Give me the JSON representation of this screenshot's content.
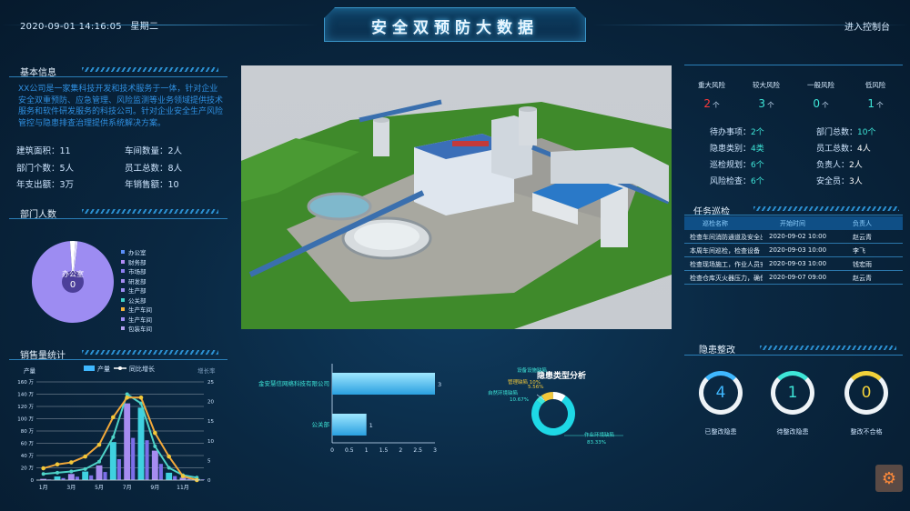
{
  "header": {
    "datetime": "2020-09-01 14:16:05",
    "weekday": "星期二",
    "title": "安全双预防大数据",
    "console_link": "进入控制台"
  },
  "basic_info": {
    "title": "基本信息",
    "description": "XX公司是一家集科技开发和技术服务于一体，针对企业安全双重预防、应急管理、风险监测等业务领域提供技术服务和软件研发服务的科技公司。针对企业安全生产风险管控与隐患排查治理提供系统解决方案。",
    "items": [
      {
        "label": "建筑面积：",
        "value": "11"
      },
      {
        "label": "车间数量：",
        "value": "2人"
      },
      {
        "label": "部门个数：",
        "value": "5人"
      },
      {
        "label": "员工总数：",
        "value": "8人"
      },
      {
        "label": "年支出额：",
        "value": "3万"
      },
      {
        "label": "年销售额：",
        "value": "10"
      }
    ]
  },
  "dept_people": {
    "title": "部门人数",
    "center_label": "办公室",
    "center_value": "0",
    "legend": [
      {
        "name": "办公室",
        "color": "#5b8ff9"
      },
      {
        "name": "财务部",
        "color": "#b28bf5"
      },
      {
        "name": "市场部",
        "color": "#8d7ef2"
      },
      {
        "name": "研发部",
        "color": "#a58cf0"
      },
      {
        "name": "生产部",
        "color": "#9c8cf2"
      },
      {
        "name": "公关部",
        "color": "#3fd1c8"
      },
      {
        "name": "生产车间",
        "color": "#f2b23a"
      },
      {
        "name": "生产车间",
        "color": "#9e8cf2"
      },
      {
        "name": "包装车间",
        "color": "#b3a0f0"
      }
    ],
    "pie": [
      {
        "name": "包装车间",
        "value": 97,
        "color": "#9d8cf2"
      },
      {
        "name": "办公室",
        "value": 2,
        "color": "#ffffff"
      },
      {
        "name": "生产车间",
        "value": 1,
        "color": "#e2dcff"
      }
    ]
  },
  "sales_stats": {
    "title": "销售量统计",
    "legend_bar": "产量",
    "legend_line": "同比增长",
    "left_axis_title": "产量",
    "right_axis_title": "增长率",
    "left_ticks": [
      "0",
      "20 万",
      "40 万",
      "60 万",
      "80 万",
      "100 万",
      "120 万",
      "140 万",
      "160 万"
    ],
    "right_ticks": [
      "0",
      "5",
      "10",
      "15",
      "20",
      "25"
    ],
    "x_ticks": [
      "1月",
      "3月",
      "5月",
      "7月",
      "9月",
      "11月"
    ]
  },
  "chart_data": [
    {
      "type": "bar+line",
      "title": "销售量统计",
      "categories": [
        "1月",
        "2月",
        "3月",
        "4月",
        "5月",
        "6月",
        "7月",
        "8月",
        "9月",
        "10月",
        "11月",
        "12月"
      ],
      "ylim": [
        0,
        160
      ],
      "ylim_right": [
        0,
        25
      ],
      "series": [
        {
          "name": "产量",
          "type": "bar",
          "values": [
            2,
            6,
            10,
            14,
            24,
            62,
            125,
            118,
            48,
            12,
            4,
            2
          ]
        },
        {
          "name": "同比增长",
          "type": "line",
          "axis": "right",
          "values": [
            3,
            4,
            4.5,
            6,
            9,
            16,
            21,
            21,
            12,
            6,
            1,
            0
          ]
        },
        {
          "type": "line",
          "axis": "left",
          "color": "#4ed3c8",
          "values": [
            10,
            12,
            14,
            18,
            30,
            70,
            140,
            125,
            55,
            20,
            8,
            4
          ]
        }
      ]
    },
    {
      "type": "bar",
      "orientation": "horizontal",
      "categories": [
        "金安慧信网络科技有限公司",
        "公关部"
      ],
      "values": [
        3,
        1
      ],
      "xlim": [
        0,
        3
      ],
      "x_ticks": [
        "0",
        "0.5",
        "1",
        "1.5",
        "2",
        "2.5",
        "3"
      ]
    },
    {
      "type": "pie",
      "title": "隐患类型分析",
      "labels": [
        "设备设施缺陷",
        "管理缺陷",
        "自然环境缺陷",
        "作业环境缺陷"
      ],
      "values": [
        5.56,
        10,
        10.67,
        83.33
      ],
      "percent_labels": [
        "5.56%",
        "10%",
        "10.67%",
        "83.33%"
      ]
    }
  ],
  "risk_stats": {
    "levels": [
      {
        "label": "重大风险",
        "value": "2",
        "unit": "个",
        "color": "#ff3a3a"
      },
      {
        "label": "较大风险",
        "value": "3",
        "unit": "个",
        "color": "#3ee6d8"
      },
      {
        "label": "一般风险",
        "value": "0",
        "unit": "个",
        "color": "#3ee6d8"
      },
      {
        "label": "低风险",
        "value": "1",
        "unit": "个",
        "color": "#3ee6d8"
      }
    ],
    "items": [
      {
        "label": "待办事项：",
        "value": "2个"
      },
      {
        "label": "部门总数：",
        "value": "10个"
      },
      {
        "label": "隐患类别：",
        "value": "4类"
      },
      {
        "label": "员工总数：",
        "value": "4人"
      },
      {
        "label": "巡检规划：",
        "value": "6个"
      },
      {
        "label": "负责人：",
        "value": "2人"
      },
      {
        "label": "风险检查：",
        "value": "6个"
      },
      {
        "label": "安全员：",
        "value": "3人"
      }
    ]
  },
  "tasks": {
    "title": "任务巡检",
    "columns": [
      "巡检名称",
      "开始时间",
      "负责人"
    ],
    "rows": [
      [
        "检查车间消防通道及安全出口",
        "2020-09-02 10:00",
        "赵云青"
      ],
      [
        "本周车间巡检，检查设备",
        "2020-09-03 10:00",
        "李飞"
      ],
      [
        "检查现场施工，作业人员安全",
        "2020-09-03 10:00",
        "钱宏雨"
      ],
      [
        "检查仓库灭火器压力，确保",
        "2020-09-07 09:00",
        "赵云青"
      ]
    ]
  },
  "hazard": {
    "title": "隐患整改",
    "rings": [
      {
        "value": "4",
        "label": "已整改隐患",
        "color": "#3fb8ff"
      },
      {
        "value": "1",
        "label": "待整改隐患",
        "color": "#3ee6d8"
      },
      {
        "value": "0",
        "label": "整改不合格",
        "color": "#f2d23a"
      }
    ]
  }
}
